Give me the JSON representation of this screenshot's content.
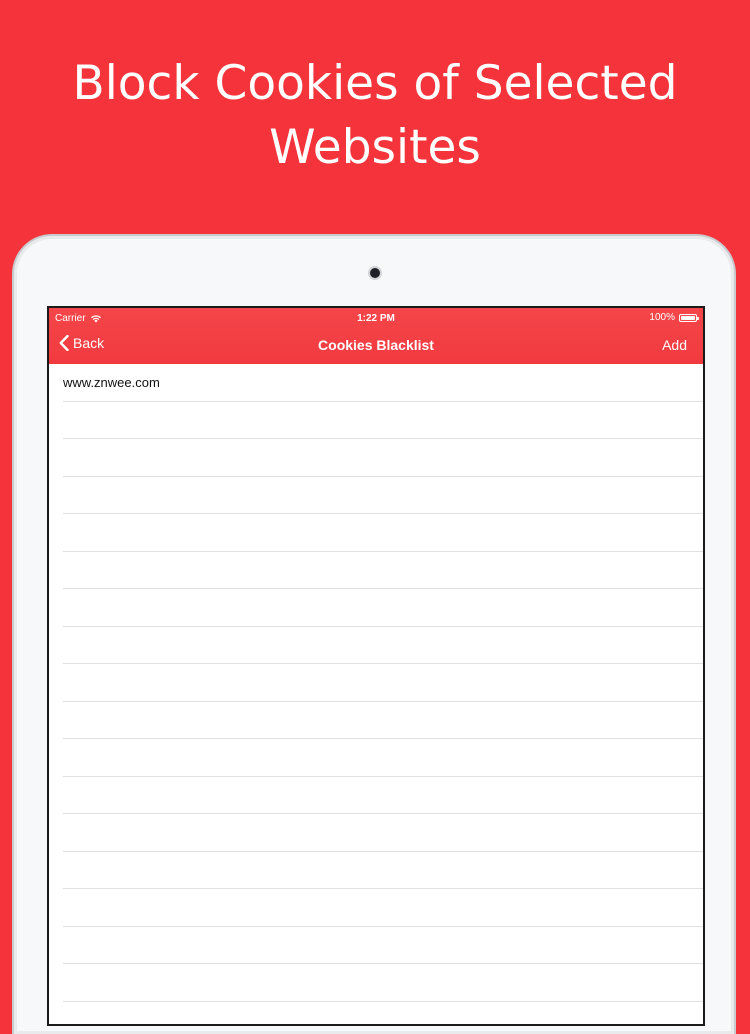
{
  "promo": {
    "line1": "Block Cookies of Selected",
    "line2": "Websites"
  },
  "status_bar": {
    "carrier": "Carrier",
    "time": "1:22 PM",
    "battery": "100%"
  },
  "navbar": {
    "back_label": "Back",
    "title": "Cookies Blacklist",
    "add_label": "Add"
  },
  "list": {
    "items": [
      "www.znwee.com",
      "",
      "",
      "",
      "",
      "",
      "",
      "",
      "",
      "",
      "",
      "",
      "",
      "",
      "",
      "",
      "",
      ""
    ]
  },
  "colors": {
    "background": "#f5333a",
    "navbar": "#f13a3f",
    "text_on_red": "#ffffff"
  },
  "icons": {
    "back": "chevron-left-icon",
    "wifi": "wifi-icon",
    "battery": "battery-icon",
    "camera": "camera-icon"
  }
}
